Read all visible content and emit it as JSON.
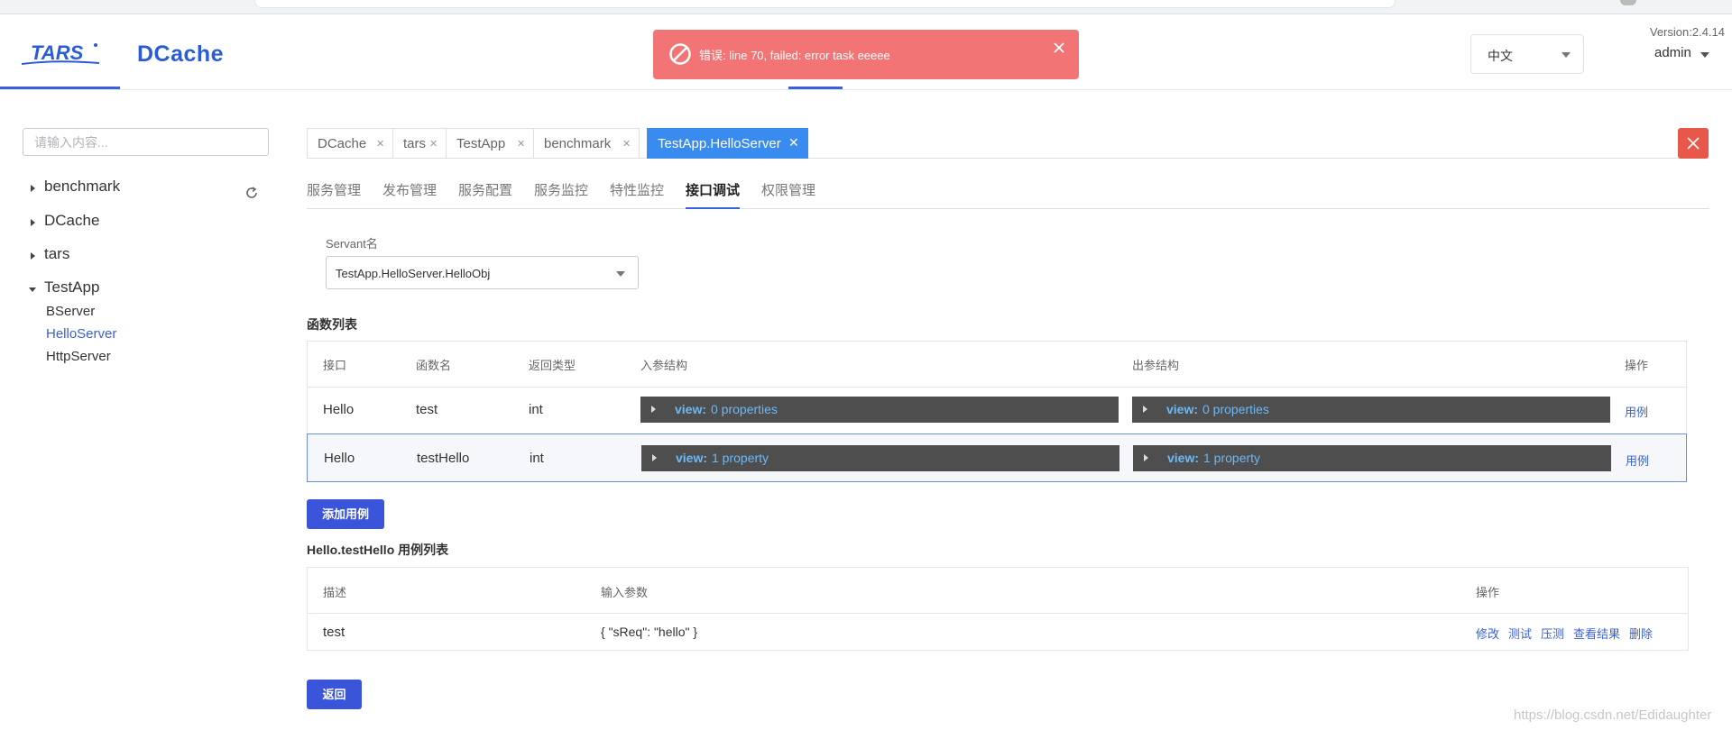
{
  "header": {
    "logo_tars": "TARS",
    "logo_dcache": "DCache",
    "version": "Version:2.4.14",
    "user": "admin",
    "language": "中文"
  },
  "toast": {
    "message": "错误: line 70, failed: error task eeeee",
    "color": "#f27474"
  },
  "sidebar": {
    "search_placeholder": "请输入内容...",
    "apps": [
      {
        "label": "benchmark",
        "expanded": false
      },
      {
        "label": "DCache",
        "expanded": false
      },
      {
        "label": "tars",
        "expanded": false
      },
      {
        "label": "TestApp",
        "expanded": true
      }
    ],
    "children": [
      {
        "label": "BServer",
        "active": false
      },
      {
        "label": "HelloServer",
        "active": true
      },
      {
        "label": "HttpServer",
        "active": false
      }
    ]
  },
  "tabs": [
    {
      "label": "DCache"
    },
    {
      "label": "tars"
    },
    {
      "label": "TestApp"
    },
    {
      "label": "benchmark"
    },
    {
      "label": "TestApp.HelloServer",
      "active": true
    }
  ],
  "subnav": [
    {
      "label": "服务管理"
    },
    {
      "label": "发布管理"
    },
    {
      "label": "服务配置"
    },
    {
      "label": "服务监控"
    },
    {
      "label": "特性监控"
    },
    {
      "label": "接口调试",
      "active": true
    },
    {
      "label": "权限管理"
    }
  ],
  "servant": {
    "label": "Servant名",
    "value": "TestApp.HelloServer.HelloObj"
  },
  "functions": {
    "title": "函数列表",
    "headers": [
      "接口",
      "函数名",
      "返回类型",
      "入参结构",
      "出参结构",
      "操作"
    ],
    "rows": [
      {
        "iface": "Hello",
        "fn": "test",
        "ret": "int",
        "in_key": "view:",
        "in_val": "0 properties",
        "out_key": "view:",
        "out_val": "0 properties",
        "action": "用例"
      },
      {
        "iface": "Hello",
        "fn": "testHello",
        "ret": "int",
        "in_key": "view:",
        "in_val": "1 property",
        "out_key": "view:",
        "out_val": "1 property",
        "action": "用例"
      }
    ]
  },
  "add_case_button": "添加用例",
  "cases": {
    "title": "Hello.testHello 用例列表",
    "headers": [
      "描述",
      "输入参数",
      "操作"
    ],
    "rows": [
      {
        "desc": "test",
        "input": "{ \"sReq\": \"hello\" }",
        "actions": [
          "修改",
          "测试",
          "压测",
          "查看结果",
          "删除"
        ]
      }
    ]
  },
  "back_button": "返回",
  "watermark": "https://blog.csdn.net/Edidaughter"
}
